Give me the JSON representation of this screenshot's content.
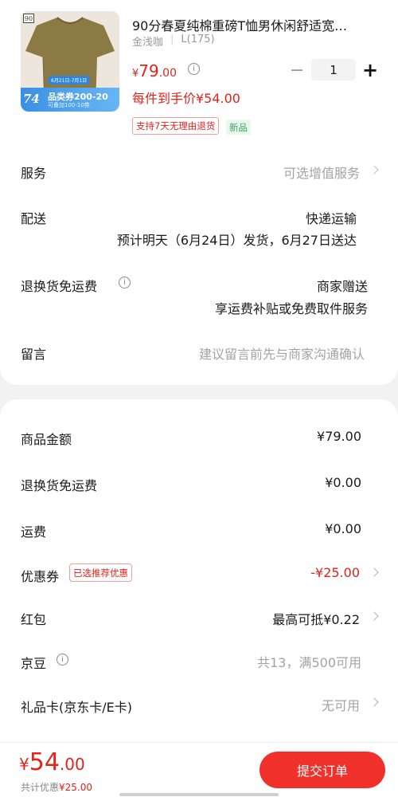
{
  "product": {
    "title": "90分春夏纯棉重磅T恤男休闲舒适宽…",
    "shop": "金浅咖",
    "spec_sep": "|",
    "spec": "L(175)",
    "price_symbol": "¥",
    "price_int": "79",
    "price_dec": ".00",
    "final_price": "每件到手价¥54.00",
    "quantity": "1",
    "minus": "−",
    "plus": "+",
    "tag_return": "支持7天无理由退货",
    "tag_new": "新品",
    "thumb": {
      "brand": "90",
      "promo_price": "74",
      "promo_main": "品类券200-20",
      "promo_sub": "可叠加100-10券",
      "promo_date": "6月21日-7月1日"
    }
  },
  "service": {
    "label": "服务",
    "value": "可选增值服务"
  },
  "delivery": {
    "label": "配送",
    "method": "快递运输",
    "schedule": "预计明天（6月24日）发货，6月27日送达"
  },
  "return_shipping": {
    "label": "退换货免运费",
    "value": "商家赠送",
    "note": "享运费补贴或免费取件服务"
  },
  "message": {
    "label": "留言",
    "placeholder": "建议留言前先与商家沟通确认"
  },
  "summary": {
    "goods_amount": {
      "label": "商品金额",
      "value": "¥79.00"
    },
    "return_free": {
      "label": "退换货免运费",
      "value": "¥0.00"
    },
    "shipping": {
      "label": "运费",
      "value": "¥0.00"
    },
    "coupon": {
      "label": "优惠券",
      "tag": "已选推荐优惠",
      "value": "-¥25.00"
    },
    "red_packet": {
      "label": "红包",
      "value": "最高可抵¥0.22"
    },
    "jd_bean": {
      "label": "京豆",
      "value": "共13，满500可用"
    },
    "gift_card": {
      "label": "礼品卡(京东卡/E卡)",
      "value": "无可用"
    }
  },
  "bottom_bar": {
    "total_symbol": "¥",
    "total_int": "54",
    "total_dec": ".00",
    "discount_label": "共计优惠",
    "discount_value": "¥25.00",
    "submit": "提交订单"
  },
  "colors": {
    "accent": "#e2231a",
    "submit_bg": "#f0312b",
    "new_tag": "#3aa65c"
  }
}
